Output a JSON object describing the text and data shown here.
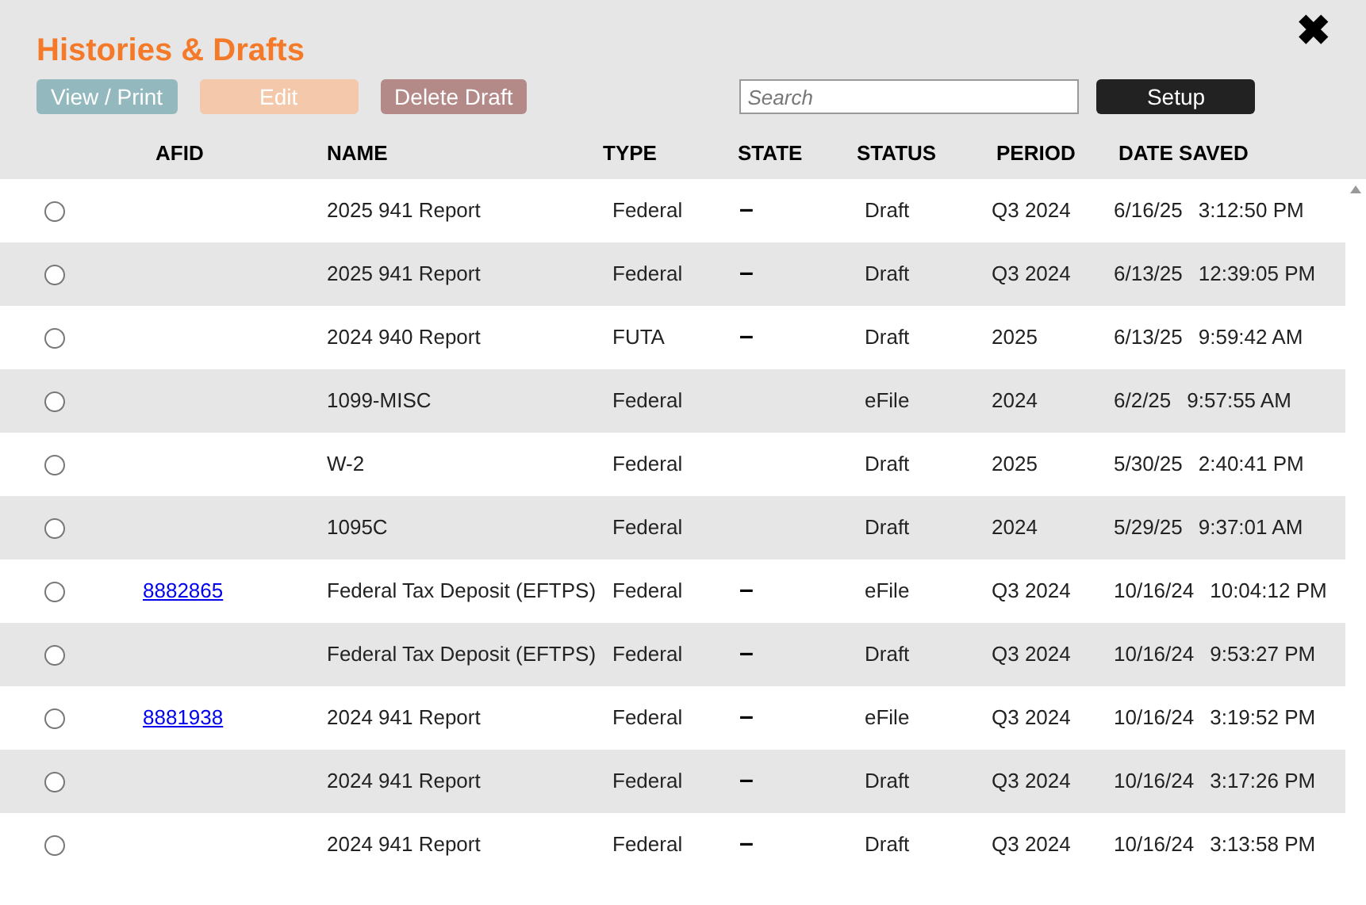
{
  "title": "Histories & Drafts",
  "close": "✖",
  "buttons": [
    {
      "label": "View / Print",
      "kind": "view"
    },
    {
      "label": "Edit",
      "kind": "edit"
    },
    {
      "label": "Delete Draft",
      "kind": "delete"
    }
  ],
  "search": {
    "placeholder": "Search"
  },
  "setup_button": "Setup",
  "table": {
    "columns": [
      "AFID",
      "NAME",
      "TYPE",
      "STATE",
      "STATUS",
      "PERIOD",
      "DATE SAVED"
    ],
    "rows": [
      {
        "selected": false,
        "afid": "",
        "name": "2025 941 Report",
        "type": "Federal",
        "state": "–",
        "status": "Draft",
        "period": "Q3 2024",
        "date": "6/16/25",
        "time": "3:12:50 PM"
      },
      {
        "selected": false,
        "afid": "",
        "name": "2025 941 Report",
        "type": "Federal",
        "state": "–",
        "status": "Draft",
        "period": "Q3 2024",
        "date": "6/13/25",
        "time": "12:39:05 PM"
      },
      {
        "selected": false,
        "afid": "",
        "name": "2024 940 Report",
        "type": "FUTA",
        "state": "–",
        "status": "Draft",
        "period": "2025",
        "date": "6/13/25",
        "time": "9:59:42 AM"
      },
      {
        "selected": false,
        "afid": "",
        "name": "1099-MISC",
        "type": "Federal",
        "state": "",
        "status": "eFile",
        "period": "2024",
        "date": "6/2/25",
        "time": "9:57:55 AM"
      },
      {
        "selected": false,
        "afid": "",
        "name": "W-2",
        "type": "Federal",
        "state": "",
        "status": "Draft",
        "period": "2025",
        "date": "5/30/25",
        "time": "2:40:41 PM"
      },
      {
        "selected": false,
        "afid": "",
        "name": "1095C",
        "type": "Federal",
        "state": "",
        "status": "Draft",
        "period": "2024",
        "date": "5/29/25",
        "time": "9:37:01 AM"
      },
      {
        "selected": false,
        "afid": "8882865",
        "name": "Federal Tax Deposit (EFTPS)",
        "type": "Federal",
        "state": "–",
        "status": "eFile",
        "period": "Q3 2024",
        "date": "10/16/24",
        "time": "10:04:12 PM"
      },
      {
        "selected": false,
        "afid": "",
        "name": "Federal Tax Deposit (EFTPS)",
        "type": "Federal",
        "state": "–",
        "status": "Draft",
        "period": "Q3 2024",
        "date": "10/16/24",
        "time": "9:53:27 PM"
      },
      {
        "selected": false,
        "afid": "8881938",
        "name": "2024 941 Report",
        "type": "Federal",
        "state": "–",
        "status": "eFile",
        "period": "Q3 2024",
        "date": "10/16/24",
        "time": "3:19:52 PM"
      },
      {
        "selected": false,
        "afid": "",
        "name": "2024 941 Report",
        "type": "Federal",
        "state": "–",
        "status": "Draft",
        "period": "Q3 2024",
        "date": "10/16/24",
        "time": "3:17:26 PM"
      },
      {
        "selected": false,
        "afid": "",
        "name": "2024 941 Report",
        "type": "Federal",
        "state": "–",
        "status": "Draft",
        "period": "Q3 2024",
        "date": "10/16/24",
        "time": "3:13:58 PM"
      }
    ]
  }
}
